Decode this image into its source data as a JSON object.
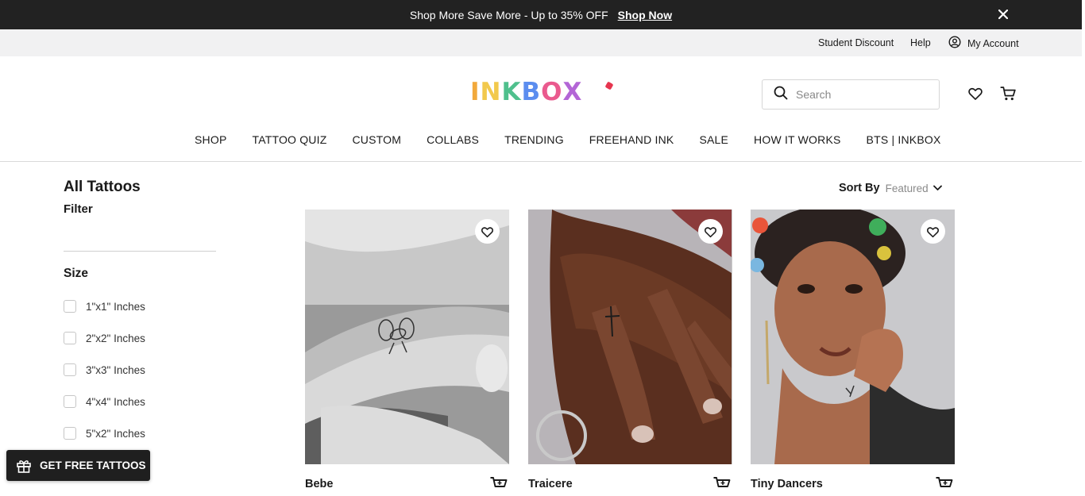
{
  "promo": {
    "text": "Shop More Save More - Up to 35% OFF",
    "cta": "Shop Now"
  },
  "utility": {
    "student": "Student Discount",
    "help": "Help",
    "account": "My Account"
  },
  "brand": {
    "logo_text": "INKBOX",
    "letter_colors": [
      "#f2a93b",
      "#f2c94c",
      "#4fc08d",
      "#5b8def",
      "#ea5a8e",
      "#b366d6"
    ]
  },
  "search": {
    "placeholder": "Search"
  },
  "nav": [
    "SHOP",
    "TATTOO QUIZ",
    "CUSTOM",
    "COLLABS",
    "TRENDING",
    "FREEHAND INK",
    "SALE",
    "HOW IT WORKS",
    "BTS | INKBOX"
  ],
  "catalog": {
    "title": "All Tattoos",
    "filter": "Filter",
    "size_heading": "Size",
    "sizes": [
      "1\"x1\" Inches",
      "2\"x2\" Inches",
      "3\"x3\" Inches",
      "4\"x4\" Inches",
      "5\"x2\" Inches"
    ],
    "sort_label": "Sort By",
    "sort_value": "Featured"
  },
  "products": [
    {
      "name": "Bebe"
    },
    {
      "name": "Traicere"
    },
    {
      "name": "Tiny Dancers"
    }
  ],
  "free_button": "GET FREE TATTOOS"
}
